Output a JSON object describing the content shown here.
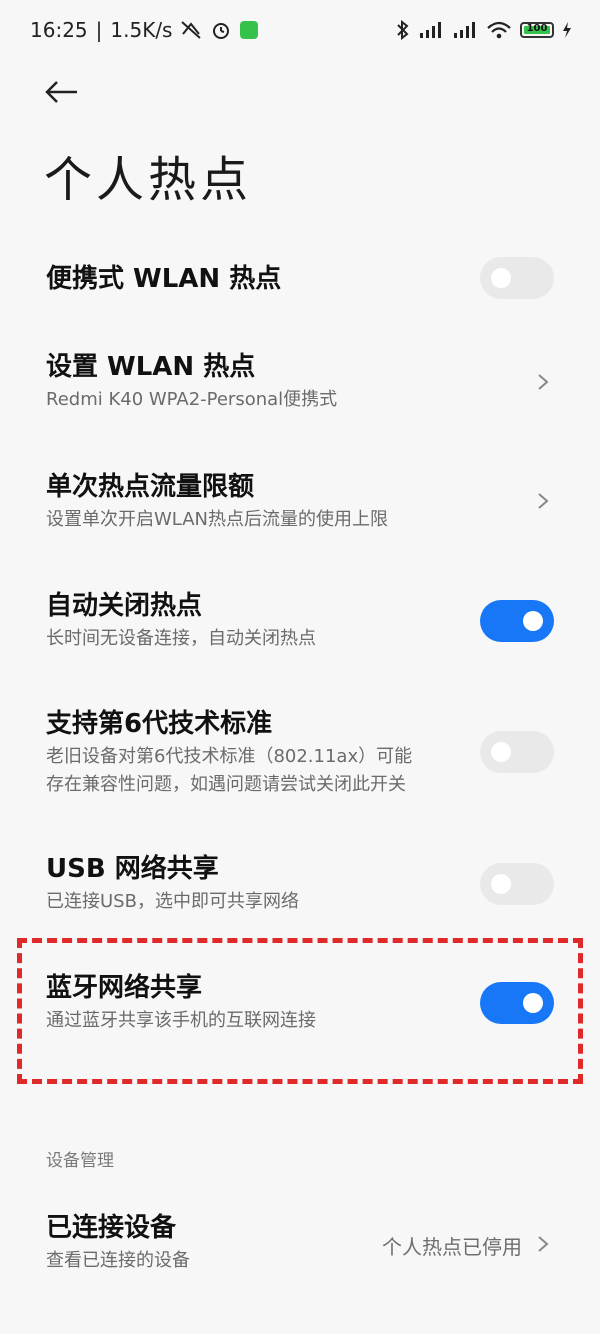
{
  "status_bar": {
    "time": "16:25",
    "separator": "|",
    "speed": "1.5K/s",
    "battery_level": "100",
    "colors": {
      "battery": "#35c24a",
      "app_icon": "#35c24a"
    }
  },
  "page": {
    "title": "个人热点"
  },
  "settings": [
    {
      "title": "便携式 WLAN 热点",
      "subtitle": "",
      "control": "toggle",
      "on": false
    },
    {
      "title": "设置 WLAN 热点",
      "subtitle": "Redmi K40 WPA2-Personal便携式",
      "control": "chevron"
    },
    {
      "title": "单次热点流量限额",
      "subtitle": "设置单次开启WLAN热点后流量的使用上限",
      "control": "chevron"
    },
    {
      "title": "自动关闭热点",
      "subtitle": "长时间无设备连接，自动关闭热点",
      "control": "toggle",
      "on": true
    },
    {
      "title": "支持第6代技术标准",
      "subtitle_line1": "老旧设备对第6代技术标准（802.11ax）可能",
      "subtitle_line2": "存在兼容性问题，如遇问题请尝试关闭此开关",
      "control": "toggle",
      "on": false
    },
    {
      "title": "USB 网络共享",
      "subtitle": "已连接USB，选中即可共享网络",
      "control": "toggle",
      "on": false
    },
    {
      "title": "蓝牙网络共享",
      "subtitle": "通过蓝牙共享该手机的互联网连接",
      "control": "toggle",
      "on": true,
      "highlighted": true
    }
  ],
  "device_section": {
    "label": "设备管理",
    "item": {
      "title": "已连接设备",
      "subtitle": "查看已连接的设备",
      "value": "个人热点已停用"
    }
  },
  "colors": {
    "toggle_on": "#1777f7",
    "toggle_off": "#e9e9e9",
    "highlight_border": "#e02a2a",
    "background": "#f7f7f7"
  }
}
